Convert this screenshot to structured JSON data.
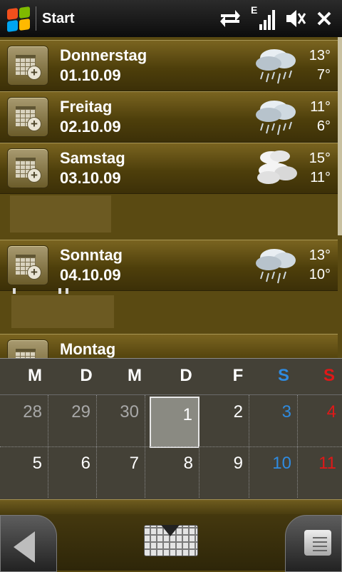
{
  "statusbar": {
    "title": "Start",
    "icons": [
      "windows-start-icon",
      "connectivity-arrows-icon",
      "signal-edge-icon",
      "volume-muted-icon",
      "close-icon"
    ],
    "network_letter": "E"
  },
  "agenda": {
    "days": [
      {
        "name": "Donnerstag",
        "date": "01.10.09",
        "weather": "rain-cloud",
        "high": "13°",
        "low": "7°"
      },
      {
        "name": "Freitag",
        "date": "02.10.09",
        "weather": "rain-cloud",
        "high": "11°",
        "low": "6°"
      },
      {
        "name": "Samstag",
        "date": "03.10.09",
        "weather": "cloudy",
        "high": "15°",
        "low": "11°"
      },
      {
        "name": "Sonntag",
        "date": "04.10.09",
        "weather": "rain-cloud",
        "high": "13°",
        "low": "10°"
      },
      {
        "name": "Montag"
      }
    ]
  },
  "calendar": {
    "weekday_headers": [
      "M",
      "D",
      "M",
      "D",
      "F",
      "S",
      "S"
    ],
    "weeks": [
      [
        "28",
        "29",
        "30",
        "1",
        "2",
        "3",
        "4"
      ],
      [
        "5",
        "6",
        "7",
        "8",
        "9",
        "10",
        "11"
      ]
    ],
    "colors": {
      "saturday": "#2f8be0",
      "sunday": "#e01818",
      "other_month": "#a8a8a8"
    }
  },
  "bottombar": {
    "icons": [
      "back-arrow-icon",
      "keyboard-icon",
      "menu-icon"
    ]
  },
  "colors": {
    "background": "#5a4a12",
    "row_top": "#7a6420",
    "row_bottom": "#3c3008"
  }
}
